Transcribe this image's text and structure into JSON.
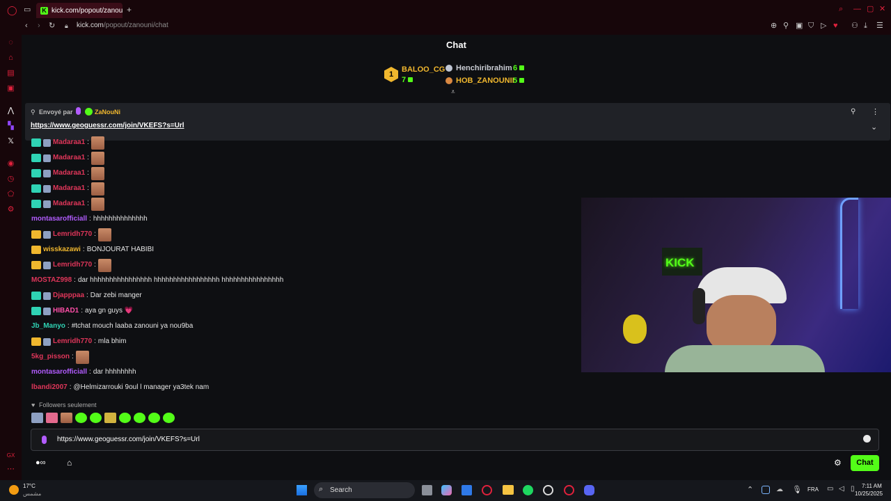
{
  "browser": {
    "tab_title": "kick.com/popout/zanouni",
    "tab_favicon": "K",
    "url_domain": "kick.com",
    "url_path": "/popout/zanouni/chat",
    "new_tab": "+"
  },
  "chat": {
    "title": "Chat",
    "leaderboard": {
      "first": {
        "rank": "1",
        "name": "BALOO_CG",
        "count": "7"
      },
      "second": {
        "name": "Henchiribrahim",
        "count": "6"
      },
      "third": {
        "name": "HOB_ZANOUNII",
        "count": "5"
      }
    },
    "pinned": {
      "prefix": "Envoyé par",
      "sender": "ZaNouNi",
      "link": "https://www.geoguessr.com/join/VKEFS?s=Url"
    },
    "messages": [
      {
        "user": "Madaraa1",
        "text": "",
        "color": "#e0365a",
        "badges": "ku",
        "emote": true
      },
      {
        "user": "Madaraa1",
        "text": "",
        "color": "#e0365a",
        "badges": "ku",
        "emote": true
      },
      {
        "user": "Madaraa1",
        "text": "",
        "color": "#e0365a",
        "badges": "ku",
        "emote": true
      },
      {
        "user": "Madaraa1",
        "text": "",
        "color": "#e0365a",
        "badges": "ku",
        "emote": true
      },
      {
        "user": "Madaraa1",
        "text": "",
        "color": "#e0365a",
        "badges": "ku",
        "emote": true
      },
      {
        "user": "montasarofficiall",
        "text": "hhhhhhhhhhhhhh",
        "color": "#b25cff",
        "badges": "",
        "emote": false
      },
      {
        "user": "Lemridh770",
        "text": "",
        "color": "#e0365a",
        "badges": "cu",
        "emote": true
      },
      {
        "user": "wisskazawi",
        "text": "BONJOURAT HABIBI",
        "color": "#f0b72e",
        "badges": "c",
        "emote": false
      },
      {
        "user": "Lemridh770",
        "text": "",
        "color": "#e0365a",
        "badges": "cu",
        "emote": true
      },
      {
        "user": "MOSTAZ998",
        "text": "dar hhhhhhhhhhhhhhhh hhhhhhhhhhhhhhhhh hhhhhhhhhhhhhhhh",
        "color": "#e0365a",
        "badges": "",
        "emote": false
      },
      {
        "user": "Djapppaa",
        "text": "Dar zebi manger",
        "color": "#e0365a",
        "badges": "ku",
        "emote": false
      },
      {
        "user": "HIBAD1",
        "text": "aya gn guys 💗",
        "color": "#ff4fa8",
        "badges": "ku",
        "emote": false
      },
      {
        "user": "Jb_Manyo",
        "text": "#tchat mouch laaba zanouni ya nou9ba",
        "color": "#2fd3b4",
        "badges": "",
        "emote": false
      },
      {
        "user": "Lemridh770",
        "text": "mla bhim",
        "color": "#e0365a",
        "badges": "cu",
        "emote": false
      },
      {
        "user": "5kg_pisson",
        "text": "",
        "color": "#e0365a",
        "badges": "",
        "emote": true
      },
      {
        "user": "montasarofficiall",
        "text": "dar hhhhhhhh",
        "color": "#b25cff",
        "badges": "",
        "emote": false
      },
      {
        "user": "lbandi2007",
        "text": "@Helmizarrouki 9oul l manager ya3tek nam",
        "color": "#e0365a",
        "badges": "",
        "emote": false
      }
    ],
    "followers_only": "Followers seulement",
    "input_value": "https://www.geoguessr.com/join/VKEFS?s=Url",
    "send_label": "Chat"
  },
  "video": {
    "sign_text": "KICK"
  },
  "taskbar": {
    "weather_temp": "17°C",
    "weather_desc": "مشمس",
    "search_label": "Search",
    "lang": "FRA",
    "time": "7:11 AM",
    "date": "10/25/2025"
  },
  "colors": {
    "accent": "#53fc18",
    "opera_red": "#e0213c"
  }
}
